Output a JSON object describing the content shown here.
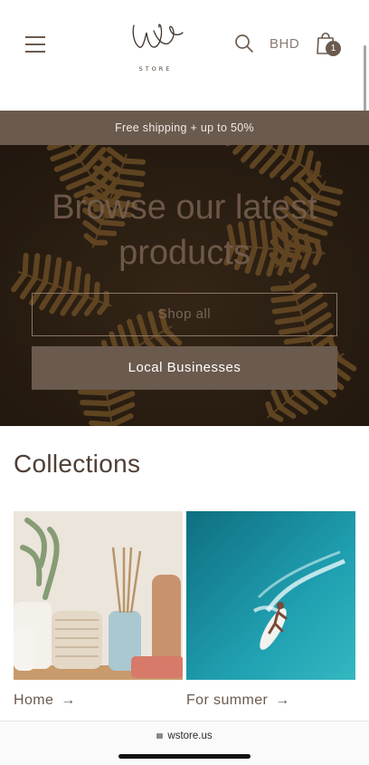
{
  "header": {
    "logo_text": "STORE",
    "currency": "BHD",
    "cart_count": "1"
  },
  "announcement": "Free shipping + up to 50%",
  "hero": {
    "title_line1": "Browse our latest",
    "title_line2": "products",
    "primary_button": "Shop all",
    "secondary_button": "Local Businesses"
  },
  "collections": {
    "title": "Collections",
    "items": [
      {
        "label": "Home"
      },
      {
        "label": "For summer"
      }
    ]
  },
  "browser": {
    "url": "wstore.us"
  },
  "colors": {
    "brand": "#6b5a4e",
    "hero_bg": "#2b1f14",
    "text": "#4e3f35"
  }
}
